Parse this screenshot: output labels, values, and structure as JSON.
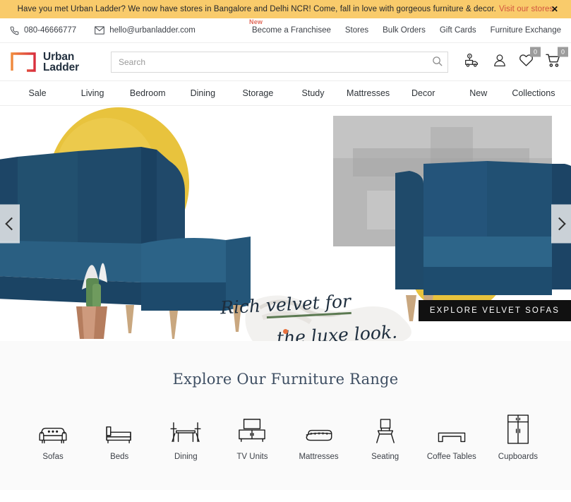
{
  "announcement": {
    "message": "Have you met Urban Ladder? We now have stores in Bangalore and Delhi NCR! Come, fall in love with gorgeous furniture & decor.",
    "link_label": "Visit our stores",
    "close_label": "✕",
    "bg_color": "#f9cb6b",
    "link_color": "#d2543f"
  },
  "utility": {
    "phone": "080-46666777",
    "email": "hello@urbanladder.com",
    "phone_icon": "phone-icon",
    "email_icon": "envelope-icon",
    "links": [
      {
        "label": "Become a Franchisee",
        "badge": "New"
      },
      {
        "label": "Stores",
        "badge": ""
      },
      {
        "label": "Bulk Orders",
        "badge": ""
      },
      {
        "label": "Gift Cards",
        "badge": ""
      },
      {
        "label": "Furniture Exchange",
        "badge": ""
      }
    ]
  },
  "header": {
    "brand_line1": "Urban",
    "brand_line2": "Ladder",
    "logo_icon": "urban-ladder-square-logo",
    "search": {
      "placeholder": "Search",
      "value": "",
      "icon": "search-icon"
    },
    "icons": [
      {
        "name": "delivery-truck-icon",
        "badge": ""
      },
      {
        "name": "user-account-icon",
        "badge": ""
      },
      {
        "name": "wishlist-heart-icon",
        "badge": "0"
      },
      {
        "name": "shopping-cart-icon",
        "badge": "0"
      }
    ]
  },
  "nav": {
    "items": [
      "Sale",
      "Living",
      "Bedroom",
      "Dining",
      "Storage",
      "Study",
      "Mattresses",
      "Decor",
      "New",
      "Collections"
    ]
  },
  "hero": {
    "script_line1_a": "Rich",
    "script_line1_b": "velvet for",
    "script_line2_a": "the",
    "script_line2_b": "luxe look",
    "script_line2_c": ".",
    "cta_label": "EXPLORE VELVET SOFAS",
    "prev_label": "‹",
    "next_label": "›",
    "dots": 1,
    "accent_dot_color": "#e8713d",
    "sofa_color": "#1d4566",
    "sun_color": "#e8c33d",
    "underline_color": "#5c7a52"
  },
  "range": {
    "title": "Explore Our Furniture Range",
    "categories": [
      {
        "label": "Sofas",
        "icon": "sofa-icon"
      },
      {
        "label": "Beds",
        "icon": "bed-icon"
      },
      {
        "label": "Dining",
        "icon": "dining-table-icon"
      },
      {
        "label": "TV Units",
        "icon": "tv-unit-icon"
      },
      {
        "label": "Mattresses",
        "icon": "mattress-icon"
      },
      {
        "label": "Seating",
        "icon": "chair-icon"
      },
      {
        "label": "Coffee Tables",
        "icon": "coffee-table-icon"
      },
      {
        "label": "Cupboards",
        "icon": "cupboard-icon"
      }
    ]
  }
}
